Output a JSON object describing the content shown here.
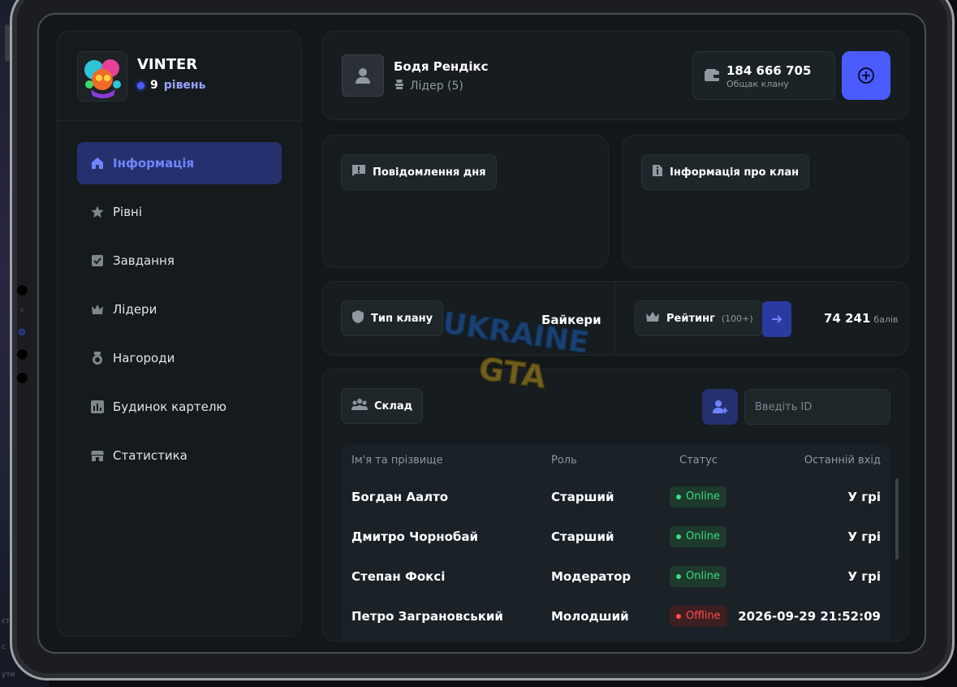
{
  "clan": {
    "name": "VINTER",
    "level_num": "9",
    "level_word": "рівень"
  },
  "menu": [
    {
      "label": "Інформація",
      "icon": "home-icon",
      "active": true
    },
    {
      "label": "Рівні",
      "icon": "star-icon"
    },
    {
      "label": "Завдання",
      "icon": "checkbox-icon"
    },
    {
      "label": "Лідери",
      "icon": "crown-icon"
    },
    {
      "label": "Нагороди",
      "icon": "medal-icon"
    },
    {
      "label": "Будинок картелю",
      "icon": "chart-icon"
    },
    {
      "label": "Статистика",
      "icon": "store-icon"
    }
  ],
  "user": {
    "name": "Бодя Рендікс",
    "role": "Лідер (5)"
  },
  "bank": {
    "value": "184 666 705",
    "label": "Общак клану"
  },
  "message_day": {
    "label": "Повідомлення дня"
  },
  "clan_info": {
    "label": "Інформація про клан"
  },
  "clan_type": {
    "label": "Тип клану",
    "value": "Байкери"
  },
  "rating": {
    "label": "Рейтинг",
    "sub": "(100+)",
    "value": "74 241",
    "unit": "балів"
  },
  "members": {
    "label": "Склад",
    "search_placeholder": "Введіть ID",
    "columns": [
      "Ім'я та прізвище",
      "Роль",
      "Статус",
      "Останній вхід"
    ],
    "rows": [
      {
        "name": "Богдан Аалто",
        "role": "Старший",
        "status": "Online",
        "last": "У грі"
      },
      {
        "name": "Дмитро Чорнобай",
        "role": "Старший",
        "status": "Online",
        "last": "У грі"
      },
      {
        "name": "Степан Фоксі",
        "role": "Модератор",
        "status": "Online",
        "last": "У грі"
      },
      {
        "name": "Петро Заграновський",
        "role": "Молодший",
        "status": "Offline",
        "last": "2026-09-29 21:52:09"
      }
    ]
  },
  "watermark": {
    "line1": "UKRAINE",
    "line2": "GTA"
  },
  "colors": {
    "accent": "#4b5cff",
    "online": "#3ddc84",
    "offline": "#ff4d4d",
    "panel": "#161c1f"
  }
}
